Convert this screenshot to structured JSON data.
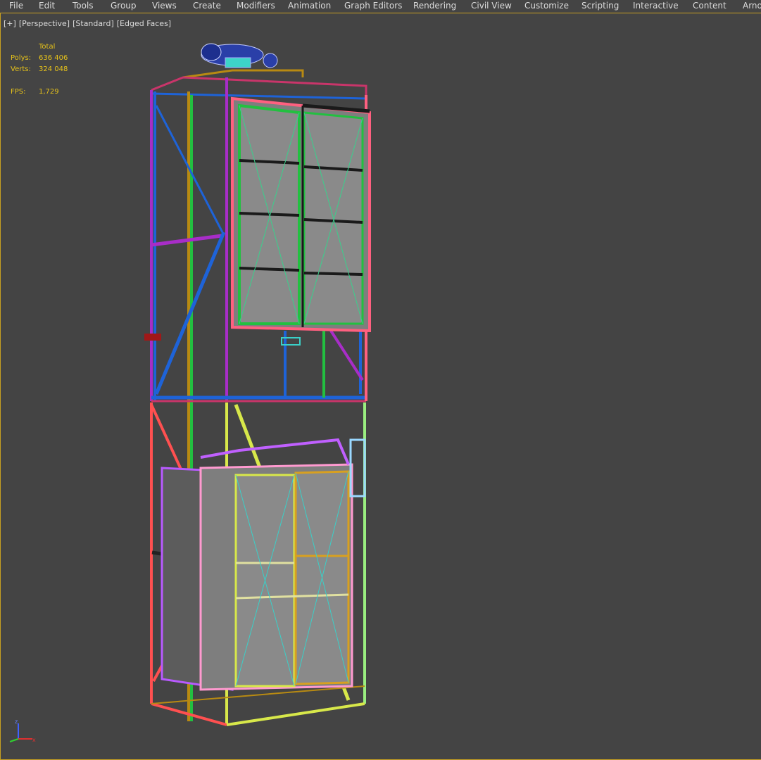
{
  "menubar": {
    "items": [
      {
        "label": "File"
      },
      {
        "label": "Edit"
      },
      {
        "label": "Tools"
      },
      {
        "label": "Group"
      },
      {
        "label": "Views"
      },
      {
        "label": "Create"
      },
      {
        "label": "Modifiers"
      },
      {
        "label": "Animation"
      },
      {
        "label": "Graph Editors"
      },
      {
        "label": "Rendering"
      },
      {
        "label": "Civil View"
      },
      {
        "label": "Customize"
      },
      {
        "label": "Scripting"
      },
      {
        "label": "Interactive"
      },
      {
        "label": "Content"
      },
      {
        "label": "Arno"
      }
    ]
  },
  "viewport": {
    "labels": {
      "plus": "[+]",
      "view": "[Perspective]",
      "shading": "[Standard]",
      "edges": "[Edged Faces]"
    },
    "stats": {
      "header": "Total",
      "polys_label": "Polys:",
      "polys_value": "636 406",
      "verts_label": "Verts:",
      "verts_value": "324 048",
      "fps_label": "FPS:",
      "fps_value": "1,729"
    },
    "border_color": "#c8a020",
    "stats_color": "#e6c21a",
    "background": "#444444",
    "gizmo": {
      "x_axis": "x",
      "z_axis": "z"
    }
  }
}
